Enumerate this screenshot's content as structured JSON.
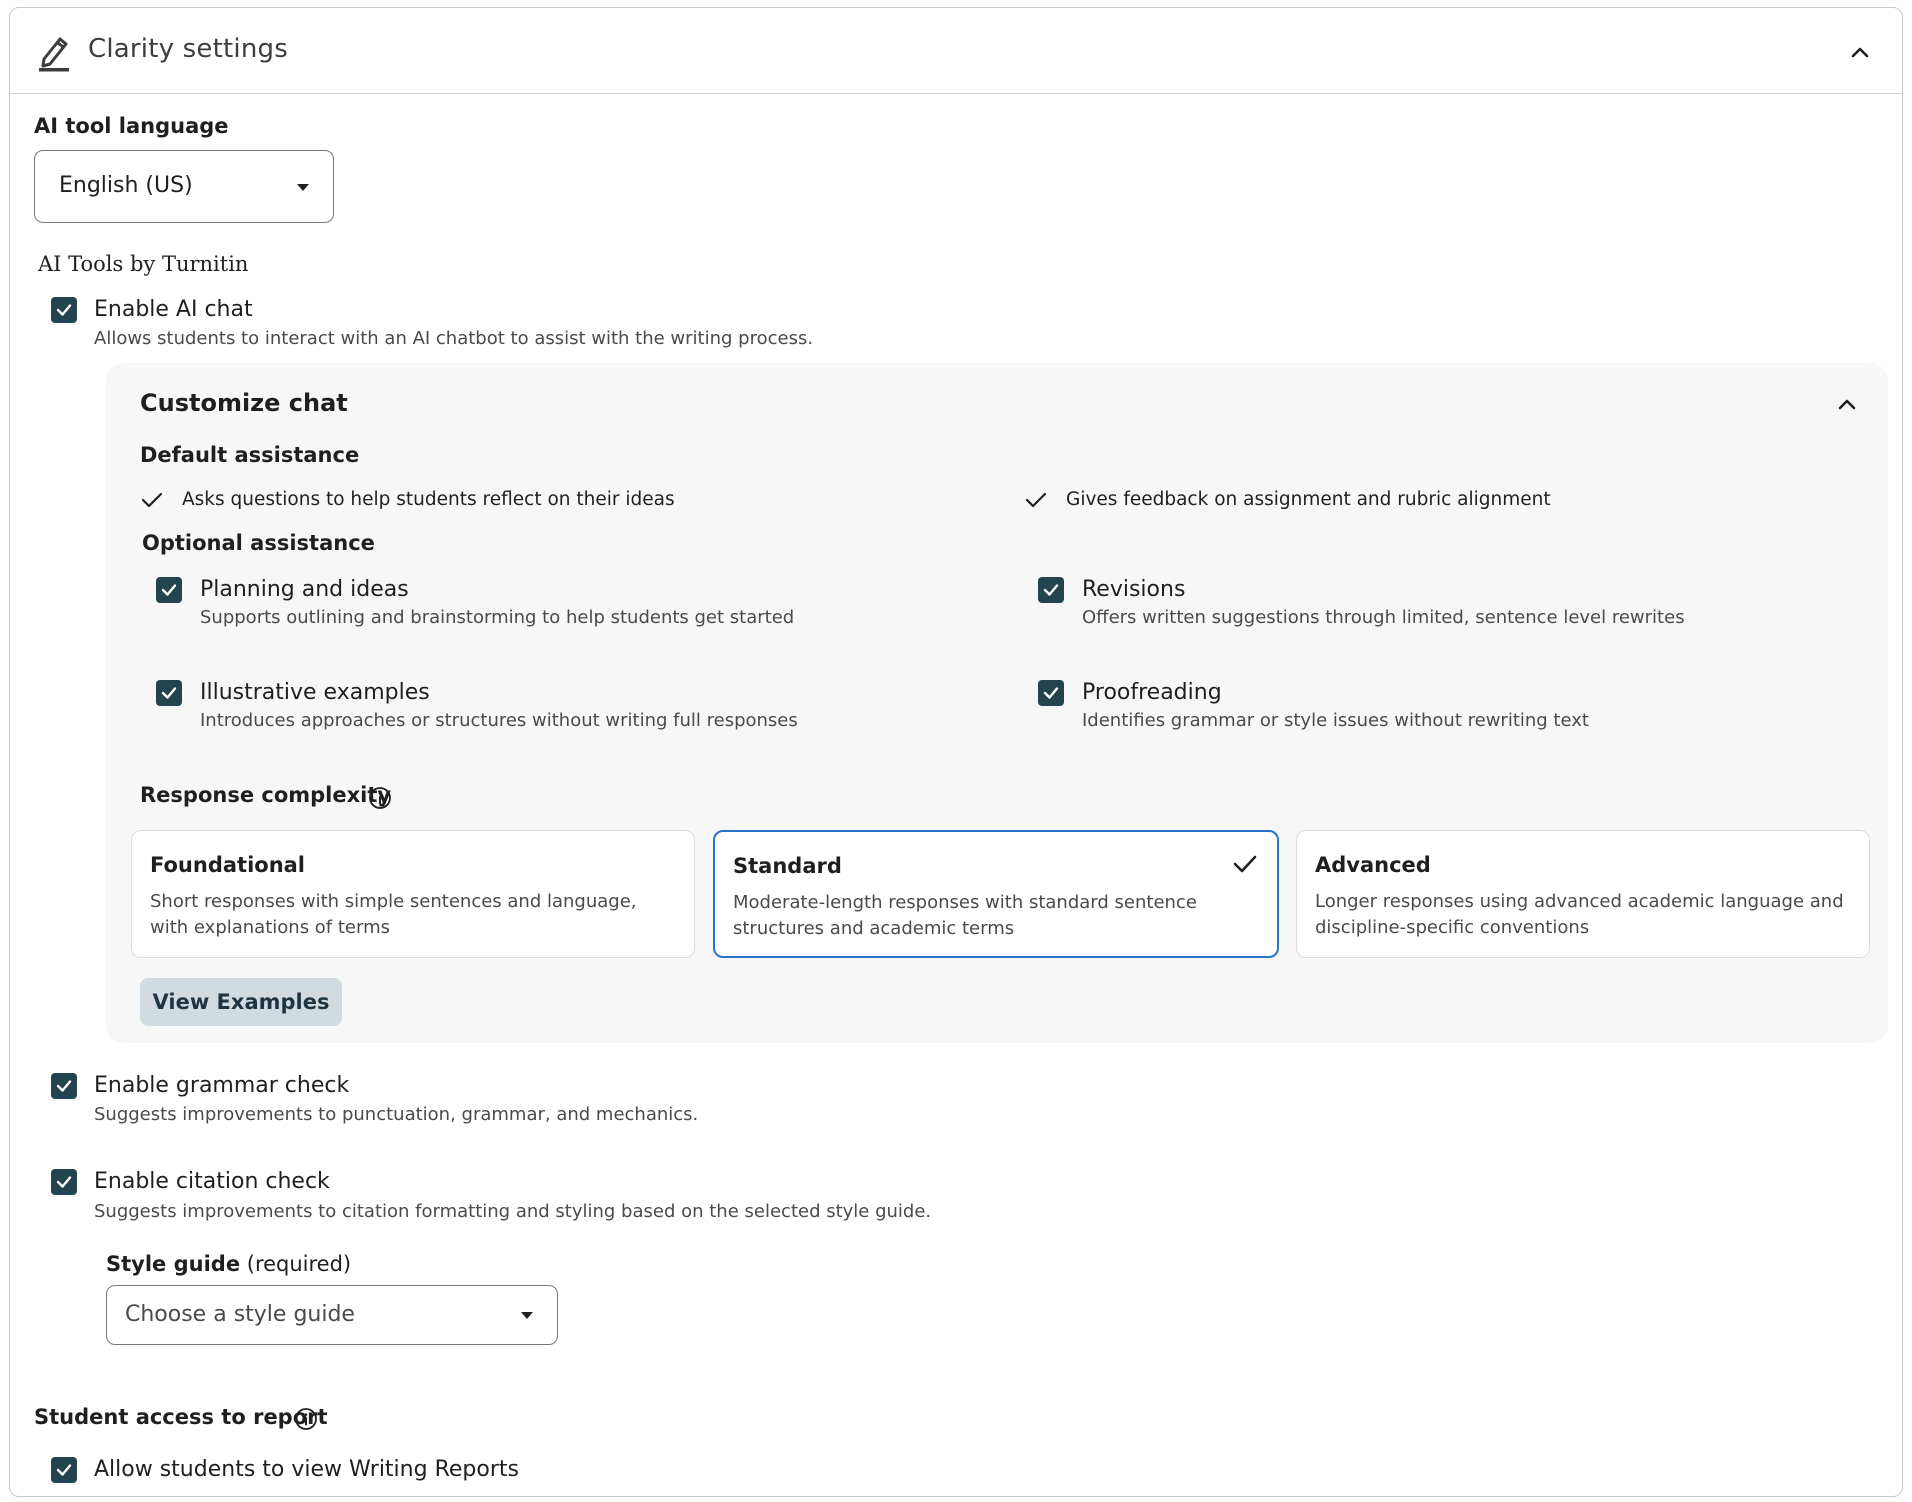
{
  "header": {
    "title": "Clarity settings"
  },
  "language": {
    "label": "AI tool language",
    "value": "English (US)"
  },
  "ai_tools": {
    "title": "AI Tools by Turnitin",
    "enable_chat": {
      "label": "Enable AI chat",
      "description": "Allows students to interact with an AI chatbot to assist with the writing process.",
      "checked": true
    }
  },
  "customize_chat": {
    "title": "Customize chat",
    "default_assistance": {
      "heading": "Default assistance",
      "items": [
        "Asks questions to help students reflect on their ideas",
        "Gives feedback on assignment and rubric alignment"
      ]
    },
    "optional_assistance": {
      "heading": "Optional assistance",
      "items": [
        {
          "label": "Planning and ideas",
          "description": "Supports outlining and brainstorming to help students get started",
          "checked": true
        },
        {
          "label": "Revisions",
          "description": "Offers written suggestions through limited, sentence level rewrites",
          "checked": true
        },
        {
          "label": "Illustrative examples",
          "description": "Introduces approaches or structures without writing full responses",
          "checked": true
        },
        {
          "label": "Proofreading",
          "description": "Identifies grammar or style issues without rewriting text",
          "checked": true
        }
      ]
    },
    "response_complexity": {
      "heading": "Response complexity",
      "selected": "Standard",
      "options": [
        {
          "title": "Foundational",
          "description": "Short responses with simple sentences and language, with explanations of terms"
        },
        {
          "title": "Standard",
          "description": "Moderate-length responses with standard sentence structures and academic terms"
        },
        {
          "title": "Advanced",
          "description": "Longer responses using advanced academic language and discipline-specific conventions"
        }
      ]
    },
    "view_examples_label": "View Examples"
  },
  "grammar_check": {
    "label": "Enable grammar check",
    "description": "Suggests improvements to punctuation, grammar, and mechanics.",
    "checked": true
  },
  "citation_check": {
    "label": "Enable citation check",
    "description": "Suggests improvements to citation formatting and styling based on the selected style guide.",
    "checked": true
  },
  "style_guide": {
    "label": "Style guide",
    "required": "(required)",
    "placeholder": "Choose a style guide"
  },
  "student_access": {
    "heading": "Student access to report",
    "allow_label": "Allow students to view Writing Reports",
    "checked": true
  },
  "colors": {
    "checkbox": "#23434f",
    "selected_border": "#2a72cf",
    "button_bg": "#d2dce0",
    "panel_bg": "#f7f7f7"
  }
}
